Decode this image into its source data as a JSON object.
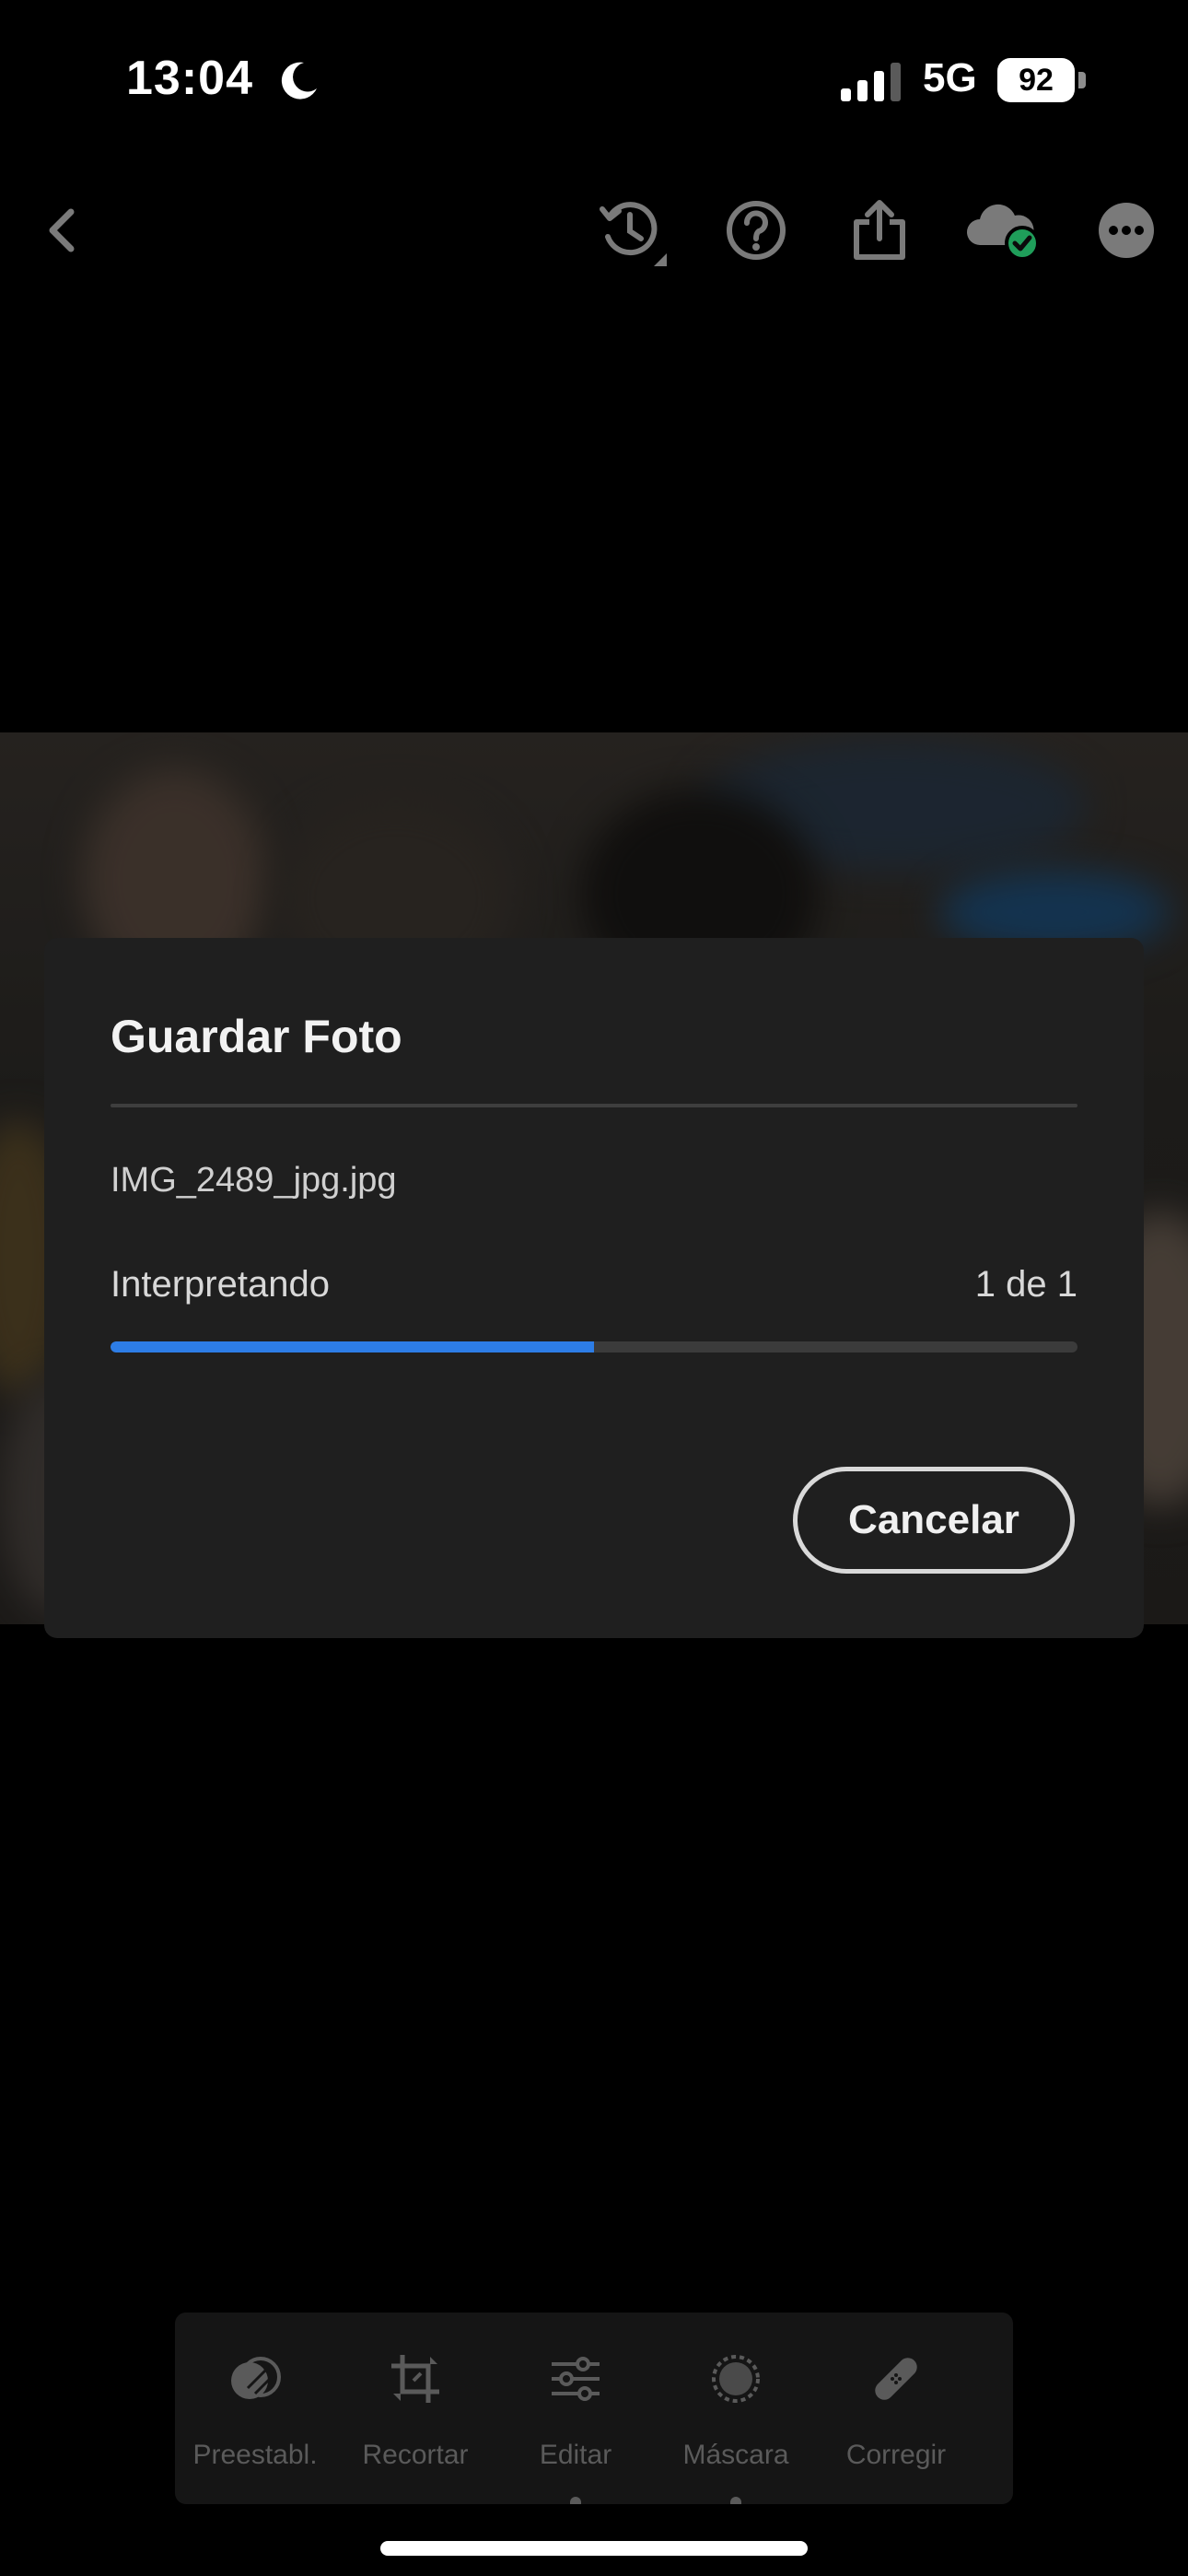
{
  "status_bar": {
    "time": "13:04",
    "network": "5G",
    "battery": "92"
  },
  "toolbar": {
    "back_icon": "chevron-left-icon",
    "history_icon": "history-icon",
    "help_icon": "help-icon",
    "share_icon": "share-icon",
    "cloud_icon": "cloud-synced-icon",
    "more_icon": "more-icon"
  },
  "dialog": {
    "title": "Guardar Foto",
    "file_name": "IMG_2489_jpg.jpg",
    "status": "Interpretando",
    "count": "1 de 1",
    "progress": 0.5,
    "cancel_label": "Cancelar"
  },
  "bottom_tools": [
    {
      "label": "Preestabl.",
      "icon": "presets-icon"
    },
    {
      "label": "Recortar",
      "icon": "crop-icon"
    },
    {
      "label": "Editar",
      "icon": "sliders-icon"
    },
    {
      "label": "Máscara",
      "icon": "mask-icon"
    },
    {
      "label": "Corregir",
      "icon": "healing-icon"
    }
  ],
  "colors": {
    "accent": "#2d7de6",
    "dialog_bg": "#1f1f1f",
    "cloud_check": "#1f9e5a"
  }
}
